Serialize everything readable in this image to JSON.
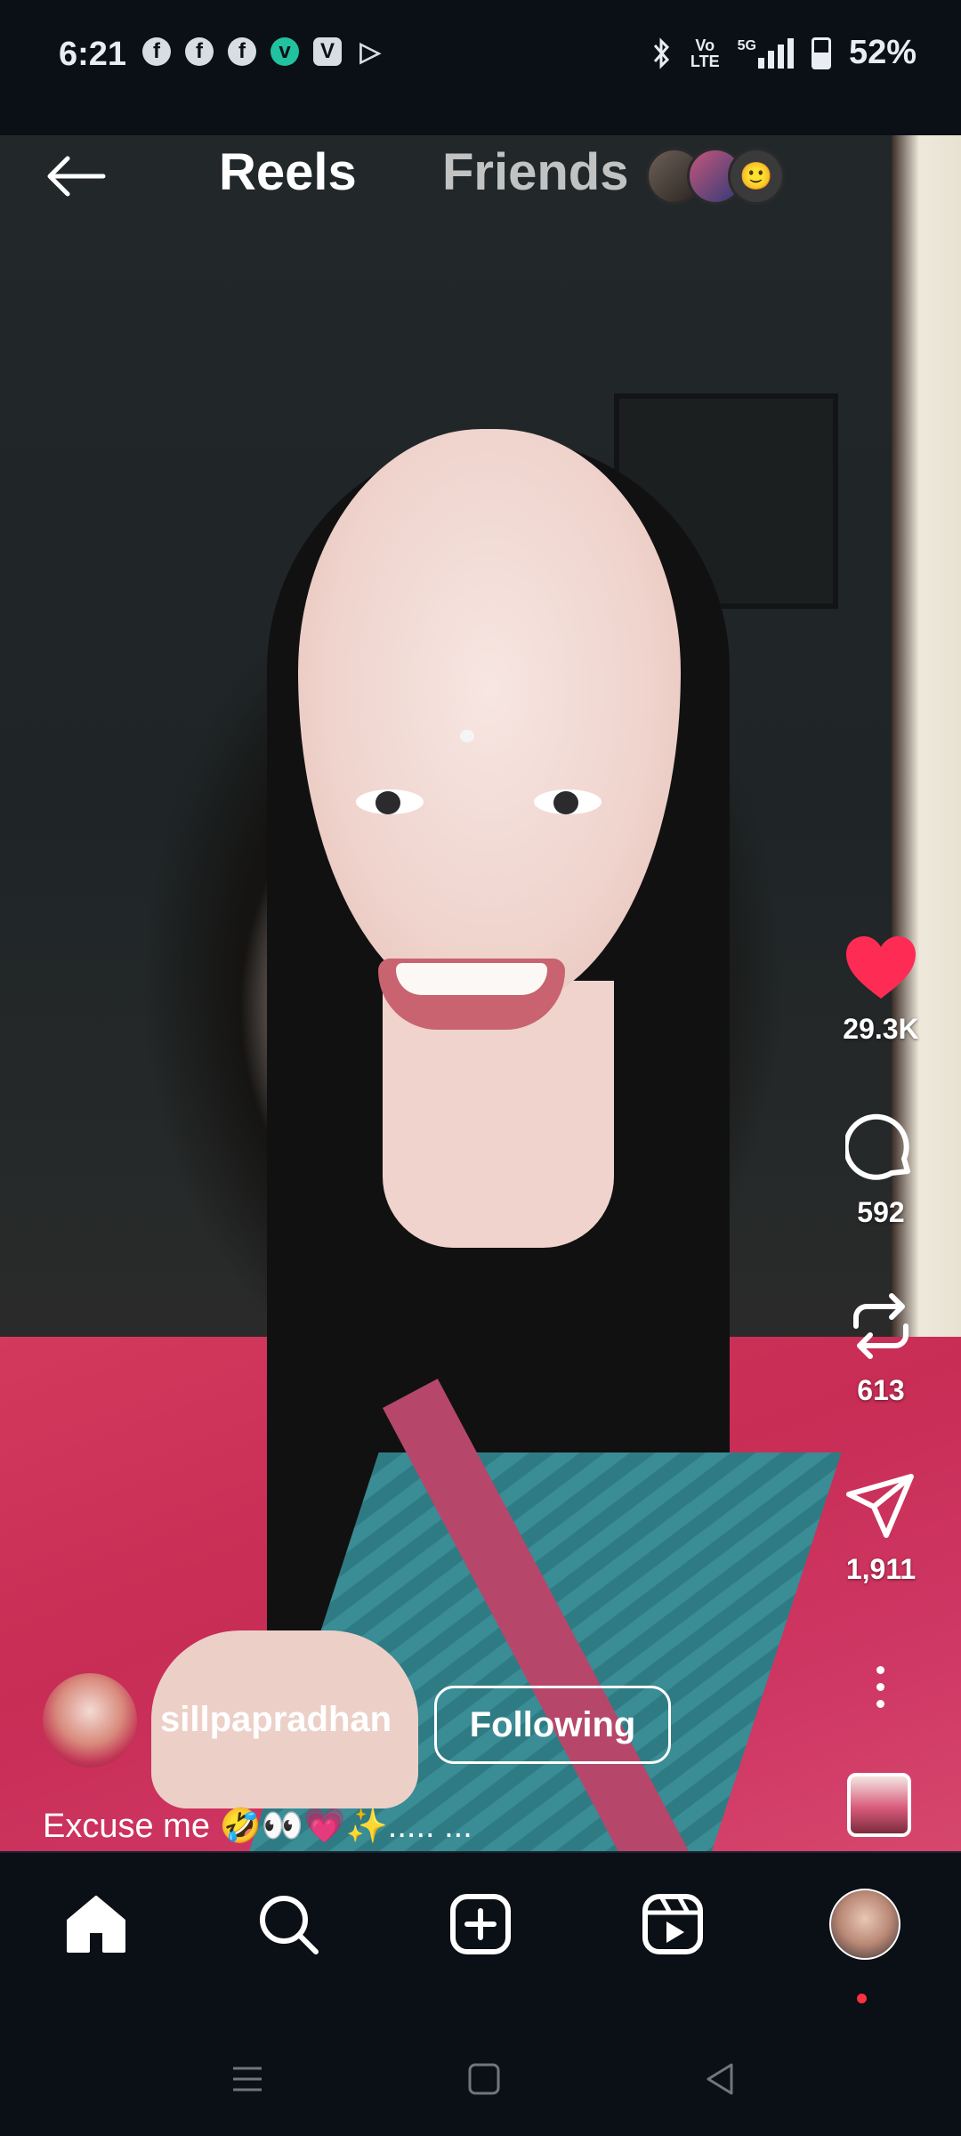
{
  "status_bar": {
    "time": "6:21",
    "notifications": [
      {
        "icon": "facebook-icon",
        "glyph": "f"
      },
      {
        "icon": "facebook-icon",
        "glyph": "f"
      },
      {
        "icon": "facebook-icon",
        "glyph": "f"
      },
      {
        "icon": "vpn-app-icon",
        "glyph": "v"
      },
      {
        "icon": "vimeo-icon",
        "glyph": "V"
      },
      {
        "icon": "play-store-icon",
        "glyph": "▷"
      }
    ],
    "volte_top": "Vo",
    "volte_bottom": "LTE",
    "network": "5G",
    "battery": "52%",
    "battery_level": 0.52
  },
  "top_nav": {
    "tabs": [
      {
        "label": "Reels",
        "active": true
      },
      {
        "label": "Friends",
        "active": false
      }
    ],
    "friend_avatar_emoji": "🙂"
  },
  "actions": {
    "likes": "29.3K",
    "comments": "592",
    "reposts": "613",
    "shares": "1,911"
  },
  "post": {
    "username": "sillpapradhan",
    "follow_label": "Following",
    "caption": "Excuse me 🤣👀💗✨..... ..."
  },
  "colors": {
    "like": "#fe2c55",
    "background": "#0b0f16",
    "notification_dot": "#ff3040"
  },
  "bottom_nav": [
    "home-icon",
    "search-icon",
    "create-icon",
    "reels-icon",
    "profile-avatar"
  ],
  "system_nav": [
    "recents-icon",
    "home-button-icon",
    "back-icon"
  ]
}
